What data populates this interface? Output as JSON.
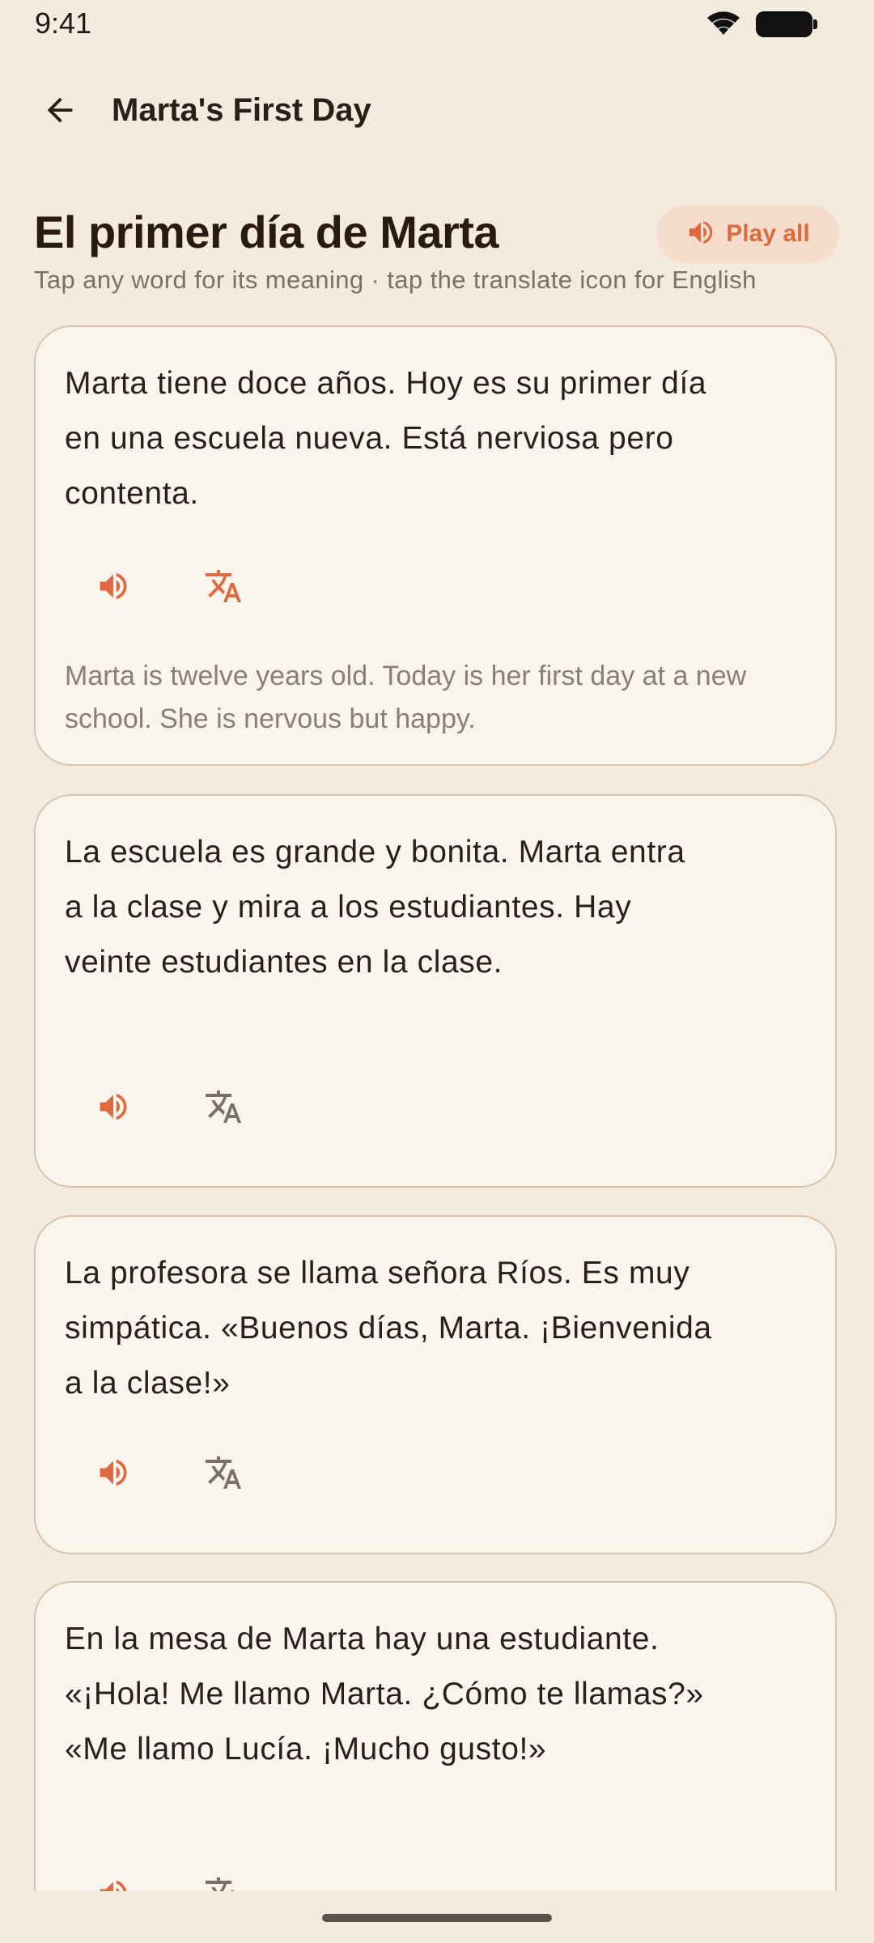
{
  "status": {
    "time": "9:41"
  },
  "app_bar": {
    "title": "Marta's First Day"
  },
  "story": {
    "title": "El primer día de Marta",
    "play_all_label": "Play all",
    "subtitle": "Tap any word for its meaning · tap the translate icon for English"
  },
  "paragraphs": [
    {
      "text": "Marta tiene doce años. Hoy es su primer día en una escuela nueva. Está nerviosa pero contenta.",
      "translation": "Marta is twelve years old. Today is her first day at a new school. She is nervous but happy.",
      "translation_visible": true
    },
    {
      "text": "La escuela es grande y bonita. Marta entra a la clase y mira a los estudiantes. Hay veinte estudiantes en la clase.",
      "translation_visible": false
    },
    {
      "text": "La profesora se llama señora Ríos. Es muy simpática. «Buenos días, Marta. ¡Bienvenida a la clase!»",
      "translation_visible": false
    },
    {
      "text": "En la mesa de Marta hay una estudiante. «¡Hola! Me llamo Marta. ¿Cómo te llamas?» «Me llamo Lucía. ¡Mucho gusto!»",
      "translation_visible": false
    }
  ],
  "icons": {
    "back": "arrow-left-icon",
    "speaker": "speaker-icon",
    "translate": "translate-icon"
  },
  "colors": {
    "background": "#f2ebde",
    "card_background": "#faf5ec",
    "card_border": "#dcc3a8",
    "accent": "#e06a3f",
    "pill_background": "#f5dccb",
    "translate_active": "#e06a3f",
    "translate_inactive": "#7a7068"
  }
}
